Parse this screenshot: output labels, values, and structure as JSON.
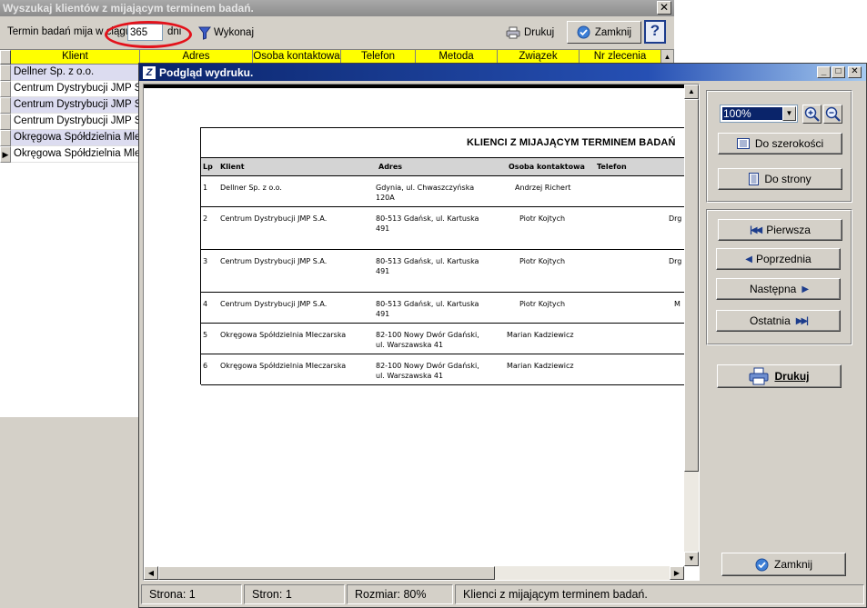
{
  "bg_window": {
    "title": "Wyszukaj klientów z mijającym terminem badań.",
    "filter_label": "Termin badań mija w ciągu",
    "days_value": "365",
    "days_unit": "dni",
    "execute_label": "Wykonaj",
    "print_label": "Drukuj",
    "close_label": "Zamknij",
    "help_label": "?",
    "grid_columns": [
      "Klient",
      "Adres",
      "Osoba kontaktowa",
      "Telefon",
      "Metoda",
      "Związek",
      "Nr zlecenia"
    ],
    "grid_rows": [
      "Dellner Sp. z o.o.",
      "Centrum Dystrybucji JMP S.A.",
      "Centrum Dystrybucji JMP S.A.",
      "Centrum Dystrybucji JMP S.A.",
      "Okręgowa Spółdzielnia Mleczarska",
      "Okręgowa Spółdzielnia Mleczarska"
    ],
    "highlight_color": "#e3121b"
  },
  "preview": {
    "title": "Podgląd wydruku.",
    "report_title": "KLIENCI Z MIJAJĄCYM TERMINEM BADAŃ",
    "report_columns": [
      "Lp",
      "Klient",
      "Adres",
      "Osoba kontaktowa",
      "Telefon"
    ],
    "report_rows": [
      {
        "lp": "1",
        "klient": "Dellner Sp. z o.o.",
        "adres": "Gdynia, ul. Chwaszczyńska\n120A",
        "osoba": "Andrzej Richert",
        "extra": ""
      },
      {
        "lp": "2",
        "klient": "Centrum Dystrybucji JMP S.A.",
        "adres": "80-513 Gdańsk, ul. Kartuska\n491",
        "osoba": "Piotr Kojtych",
        "extra": "Drg"
      },
      {
        "lp": "3",
        "klient": "Centrum Dystrybucji JMP S.A.",
        "adres": "80-513 Gdańsk, ul. Kartuska\n491",
        "osoba": "Piotr Kojtych",
        "extra": "Drg"
      },
      {
        "lp": "4",
        "klient": "Centrum Dystrybucji JMP S.A.",
        "adres": "80-513 Gdańsk, ul. Kartuska\n491",
        "osoba": "Piotr Kojtych",
        "extra": "M"
      },
      {
        "lp": "5",
        "klient": "Okręgowa Spółdzielnia Mleczarska",
        "adres": "82-100 Nowy Dwór Gdański,\nul. Warszawska 41",
        "osoba": "Marian Kadziewicz",
        "extra": ""
      },
      {
        "lp": "6",
        "klient": "Okręgowa Spółdzielnia Mleczarska",
        "adres": "82-100 Nowy Dwór Gdański,\nul. Warszawska 41",
        "osoba": "Marian Kadziewicz",
        "extra": ""
      }
    ],
    "zoom_value": "100%",
    "fit_width_label": "Do szerokości",
    "fit_page_label": "Do strony",
    "first_label": "Pierwsza",
    "prev_label": "Poprzednia",
    "next_label": "Następna",
    "last_label": "Ostatnia",
    "print_label": "Drukuj",
    "close_label": "Zamknij",
    "status": {
      "page": "Strona: 1",
      "pages": "Stron: 1",
      "size": "Rozmiar: 80%",
      "description": "Klienci z mijającym terminem badań."
    }
  }
}
